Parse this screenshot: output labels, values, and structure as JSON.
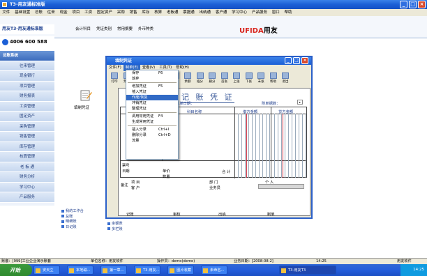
{
  "window": {
    "title": "T3-用友通标准版"
  },
  "menubar": [
    "文件",
    "基础设置",
    "总账",
    "往来",
    "现金",
    "项目",
    "工资",
    "固定资产",
    "采购",
    "销售",
    "库存",
    "核算",
    "老板通",
    "票据通",
    "出纳通",
    "客户通",
    "学习中心",
    "产品服务",
    "窗口",
    "帮助"
  ],
  "toolbar": {
    "brand": "用友T3-用友通标准版",
    "phone": "4006 600 588",
    "items": [
      "会计科目",
      "凭证类别",
      "常用摘要",
      "外币种类"
    ],
    "logo": "UFIDA",
    "logo_cn": "用友"
  },
  "sidebar": {
    "items": [
      "总账系统",
      "往来管理",
      "现金银行",
      "项目管理",
      "财务报表",
      "工资管理",
      "固定资产",
      "采购管理",
      "销售管理",
      "库存管理",
      "核算管理",
      "老 板 通",
      "财务分析",
      "学习中心",
      "产品服务"
    ]
  },
  "main": {
    "doc_label": "填制凭证"
  },
  "links": {
    "col1": [
      "我的工作台",
      "总账",
      "明细账",
      "日记账"
    ],
    "col2": [
      "余额表",
      "多栏账"
    ]
  },
  "dialog": {
    "title": "填制凭证",
    "menus": [
      "文件(F)",
      "制单(E)",
      "查看(V)",
      "工具(T)",
      "帮助(H)"
    ],
    "tools": [
      "打印",
      "预览",
      "输出",
      "",
      "流量",
      "备查",
      "余额",
      "插分",
      "删分",
      "首张",
      "上张",
      "下张",
      "末张",
      "帮助",
      "退出"
    ],
    "voucher_title": "记 账 凭 证",
    "fields": {
      "date": "制单日期：",
      "attach": "附单据数：",
      "subject": "科目名称",
      "debit": "借方金额",
      "credit": "贷方金额",
      "note1": "票号",
      "note2": "日期",
      "unit": "单价",
      "qty": "数量",
      "total": "合 计",
      "remark": "备注",
      "project": "项 目",
      "dept": "部 门",
      "person": "个 人",
      "client": "客 户",
      "business": "业务员",
      "record": "记账",
      "audit": "审核",
      "cashier": "出纳",
      "maker": "制单"
    }
  },
  "dropdown": {
    "items": [
      {
        "label": "保存",
        "shortcut": "F6"
      },
      {
        "label": "放弃",
        "shortcut": ""
      },
      {
        "sep": true
      },
      {
        "label": "增加凭证",
        "shortcut": "F5"
      },
      {
        "label": "插入凭证",
        "shortcut": ""
      },
      {
        "label": "作废/恢复",
        "shortcut": "",
        "hl": true
      },
      {
        "label": "冲销凭证",
        "shortcut": ""
      },
      {
        "label": "整理凭证",
        "shortcut": ""
      },
      {
        "sep": true
      },
      {
        "label": "调用常用凭证",
        "shortcut": "F4"
      },
      {
        "label": "生成常用凭证",
        "shortcut": ""
      },
      {
        "sep": true
      },
      {
        "label": "插入分录",
        "shortcut": "Ctrl+I"
      },
      {
        "label": "删除分录",
        "shortcut": "Ctrl+D"
      },
      {
        "label": "流量",
        "shortcut": ""
      }
    ]
  },
  "statusbar": {
    "account": "账套：[999]工业企业演示账套",
    "unit": "单位名称：用友软件",
    "operator": "操作员：demo(demo)",
    "date": "业务日期：[2008-08-2]",
    "time": "14:25",
    "company": "用友软件"
  },
  "taskbar": {
    "start": "开始",
    "tasks": [
      "安天立",
      "本地磁...",
      "第一章...",
      "T3-用友...",
      "图片收藏",
      "未命名...",
      "T3-用友T3"
    ],
    "active_index": 6,
    "clock": "14:25"
  }
}
